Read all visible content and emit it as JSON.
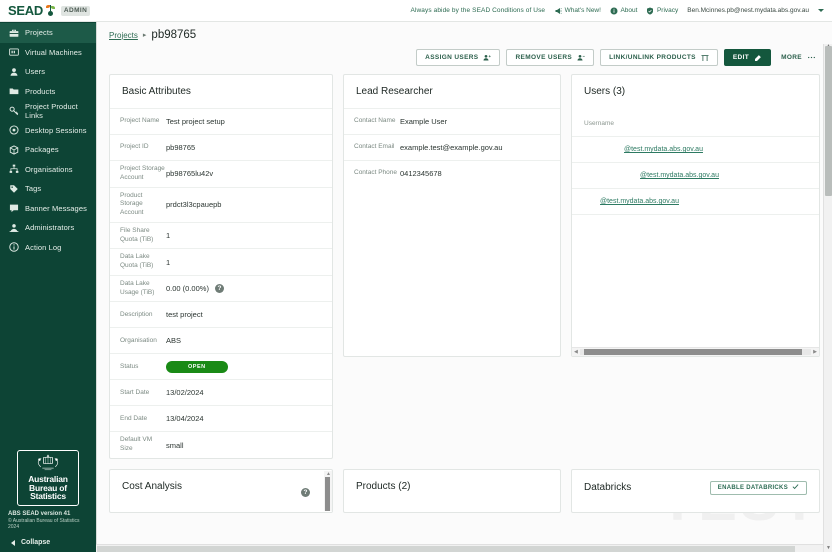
{
  "brand": {
    "logo_text": "SEAD",
    "admin_badge": "ADMIN",
    "accent_green": "#14573d",
    "link_green": "#2d6b52",
    "status_green": "#1a8a16"
  },
  "topbar": {
    "notice": "Always abide by the SEAD Conditions of Use",
    "items": [
      {
        "label": "What's New!",
        "icon": "megaphone-icon"
      },
      {
        "label": "About",
        "icon": "info-icon"
      },
      {
        "label": "Privacy",
        "icon": "shield-icon"
      }
    ],
    "user_email": "Ben.Mcinnes.pb@nest.mydata.abs.gov.au"
  },
  "sidebar": {
    "items": [
      {
        "label": "Projects",
        "icon": "briefcase-icon",
        "active": true
      },
      {
        "label": "Virtual Machines",
        "icon": "monitor-icon",
        "active": false
      },
      {
        "label": "Users",
        "icon": "user-icon",
        "active": false
      },
      {
        "label": "Products",
        "icon": "folder-icon",
        "active": false
      },
      {
        "label": "Project Product Links",
        "icon": "key-icon",
        "active": false
      },
      {
        "label": "Desktop Sessions",
        "icon": "target-icon",
        "active": false
      },
      {
        "label": "Packages",
        "icon": "box-icon",
        "active": false
      },
      {
        "label": "Organisations",
        "icon": "sitemap-icon",
        "active": false
      },
      {
        "label": "Tags",
        "icon": "tag-icon",
        "active": false
      },
      {
        "label": "Banner Messages",
        "icon": "message-icon",
        "active": false
      },
      {
        "label": "Administrators",
        "icon": "admin-user-icon",
        "active": false
      },
      {
        "label": "Action Log",
        "icon": "info-circle-icon",
        "active": false
      }
    ],
    "footer": {
      "org_line1": "Australian",
      "org_line2": "Bureau of",
      "org_line3": "Statistics",
      "version": "ABS SEAD version 41",
      "copyright": "© Australian Bureau of Statistics 2024",
      "collapse_label": "Collapse"
    }
  },
  "breadcrumb": {
    "parent": "Projects",
    "separator": "▸",
    "current": "pb98765"
  },
  "actions": [
    {
      "label": "ASSIGN USERS",
      "icon": "user-plus-icon",
      "style": "outline"
    },
    {
      "label": "REMOVE USERS",
      "icon": "user-minus-icon",
      "style": "outline"
    },
    {
      "label": "LINK/UNLINK PRODUCTS",
      "icon": "link-icon",
      "style": "outline"
    },
    {
      "label": "EDIT",
      "icon": "pencil-icon",
      "style": "primary"
    },
    {
      "label": "MORE",
      "icon": "ellipsis-icon",
      "style": "plain"
    }
  ],
  "basic_attributes": {
    "title": "Basic Attributes",
    "rows": [
      {
        "key": "Project Name",
        "value": "Test project setup"
      },
      {
        "key": "Project ID",
        "value": "pb98765"
      },
      {
        "key": "Project Storage Account",
        "value": "pb98765lu42v"
      },
      {
        "key": "Product Storage Account",
        "value": "prdct3l3cpauepb"
      },
      {
        "key": "File Share Quota (TiB)",
        "value": "1"
      },
      {
        "key": "Data Lake Quota (TiB)",
        "value": "1"
      },
      {
        "key": "Data Lake Usage (TiB)",
        "value": "0.00 (0.00%)",
        "help": "?"
      },
      {
        "key": "Description",
        "value": "test project"
      },
      {
        "key": "Organisation",
        "value": "ABS"
      },
      {
        "key": "Status",
        "value": "OPEN",
        "type": "pill"
      },
      {
        "key": "Start Date",
        "value": "13/02/2024"
      },
      {
        "key": "End Date",
        "value": "13/04/2024"
      },
      {
        "key": "Default VM Size",
        "value": "small"
      }
    ]
  },
  "lead_researcher": {
    "title": "Lead Researcher",
    "rows": [
      {
        "key": "Contact Name",
        "value": "Example User"
      },
      {
        "key": "Contact Email",
        "value": "example.test@example.gov.au"
      },
      {
        "key": "Contact Phone",
        "value": "0412345678"
      }
    ]
  },
  "users_card": {
    "title": "Users (3)",
    "column_header": "Username",
    "rows": [
      {
        "username": "@test.mydata.abs.gov.au"
      },
      {
        "username": "@test.mydata.abs.gov.au"
      },
      {
        "username": "@test.mydata.abs.gov.au"
      }
    ]
  },
  "bottom_cards": {
    "cost_analysis": {
      "title": "Cost Analysis",
      "help": "?"
    },
    "products": {
      "title": "Products (2)"
    },
    "databricks": {
      "title": "Databricks",
      "button_label": "ENABLE DATABRICKS"
    }
  },
  "watermark": "TEST"
}
